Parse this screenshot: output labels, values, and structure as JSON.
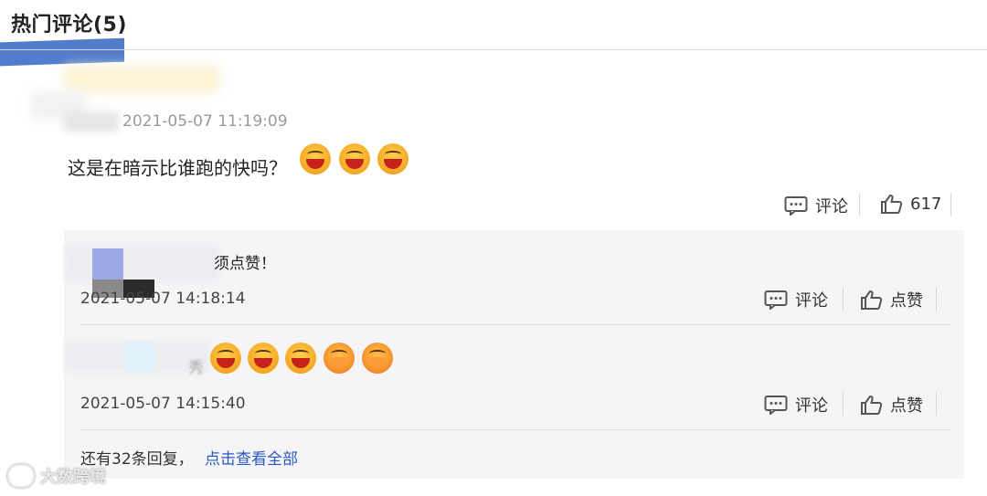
{
  "header": {
    "title": "热门评论(5)"
  },
  "main_comment": {
    "time_suffix": "2021-05-07 11:19:09",
    "text": "这是在暗示比谁跑的快吗？",
    "emojis": [
      "laugh-emoji",
      "laugh-emoji",
      "laugh-emoji"
    ],
    "comment_label": "评论",
    "like_count": "617"
  },
  "replies": [
    {
      "text_fragment": "须点赞！",
      "time": "2021-05-07 14:18:14",
      "comment_label": "评论",
      "like_label": "点赞"
    },
    {
      "text_fragment": "秀",
      "emojis": [
        "laugh-emoji",
        "laugh-emoji",
        "laugh-emoji",
        "shy-emoji",
        "shy-emoji"
      ],
      "time": "2021-05-07 14:15:40",
      "comment_label": "评论",
      "like_label": "点赞"
    }
  ],
  "more": {
    "text": "还有32条回复，",
    "link": "点击查看全部"
  },
  "watermark": {
    "text": "大数跨境"
  },
  "colors": {
    "accent": "#2a56c6",
    "header_underline": "#3f6fc7"
  }
}
